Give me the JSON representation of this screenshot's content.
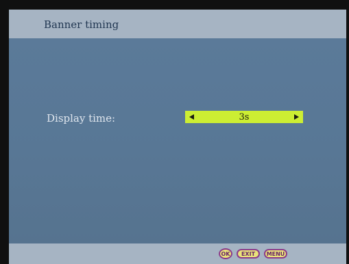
{
  "header": {
    "title": "Banner timing"
  },
  "setting": {
    "label": "Display time:",
    "value": "3s"
  },
  "footer": {
    "ok_label": "OK",
    "exit_label": "EXIT",
    "menu_label": "MENU"
  },
  "icons": {
    "decrease": "left-arrow-icon",
    "increase": "right-arrow-icon"
  },
  "colors": {
    "background": "#5a7896",
    "title_bar": "#a6b4c3",
    "value_highlight": "#ccee33",
    "button_fill": "#e9e37a",
    "button_border": "#8b3a8a"
  }
}
